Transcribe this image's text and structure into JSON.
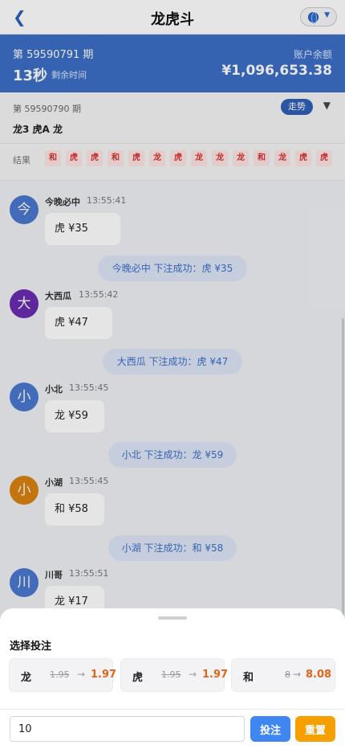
{
  "nav": {
    "back_icon": "chevron-left-icon",
    "back_glyph": "❮",
    "title": "龙虎斗",
    "lang_icon": "globe-icon",
    "lang_caret": "▼"
  },
  "header": {
    "issue": "第 59590791 期",
    "countdown": "13秒",
    "countdown_label": "剩余时间",
    "balance_label": "账户余额",
    "balance": "¥1,096,653.38"
  },
  "previous": {
    "issue": "第 59590790 期",
    "result": "龙3 虎A 龙",
    "trend_button": "走势",
    "trend_caret": "▼"
  },
  "results_strip": {
    "label": "结果",
    "items": [
      "和",
      "虎",
      "虎",
      "和",
      "虎",
      "龙",
      "虎",
      "龙",
      "龙",
      "龙",
      "和",
      "龙",
      "虎",
      "虎"
    ]
  },
  "chat": {
    "messages": [
      {
        "type": "user",
        "avatar_char": "今",
        "avatar_color": "#4a78d0",
        "name": "今晚必中",
        "time": "13:55:41",
        "text": "虎 ¥35"
      },
      {
        "type": "system",
        "text": "今晚必中 下注成功：虎 ¥35"
      },
      {
        "type": "user",
        "avatar_char": "大",
        "avatar_color": "#6a2cb0",
        "name": "大西瓜",
        "time": "13:55:42",
        "text": "虎 ¥47"
      },
      {
        "type": "system",
        "text": "大西瓜 下注成功：虎 ¥47"
      },
      {
        "type": "user",
        "avatar_char": "小",
        "avatar_color": "#4a78d0",
        "name": "小北",
        "time": "13:55:45",
        "text": "龙 ¥59"
      },
      {
        "type": "system",
        "text": "小北 下注成功：龙 ¥59"
      },
      {
        "type": "user",
        "avatar_char": "小",
        "avatar_color": "#d9820f",
        "name": "小湖",
        "time": "13:55:45",
        "text": "和 ¥58"
      },
      {
        "type": "system",
        "text": "小湖 下注成功：和 ¥58"
      },
      {
        "type": "user",
        "avatar_char": "川",
        "avatar_color": "#4a78d0",
        "name": "川哥",
        "time": "13:55:51",
        "text": "龙 ¥17"
      }
    ]
  },
  "bet_sheet": {
    "title": "选择投注",
    "options": [
      {
        "name": "龙",
        "old_odds": "1.95",
        "arrow": "→",
        "new_odds": "1.97"
      },
      {
        "name": "虎",
        "old_odds": "1.95",
        "arrow": "→",
        "new_odds": "1.97"
      },
      {
        "name": "和",
        "old_odds": "8",
        "arrow": "→",
        "new_odds": "8.08"
      }
    ],
    "amount_value": "10",
    "bet_button": "投注",
    "reset_button": "重置"
  },
  "colors": {
    "brand_blue": "#3b6fc6",
    "accent_orange": "#e0661a",
    "reset_orange": "#f5a000",
    "bet_blue": "#3f86f0"
  }
}
